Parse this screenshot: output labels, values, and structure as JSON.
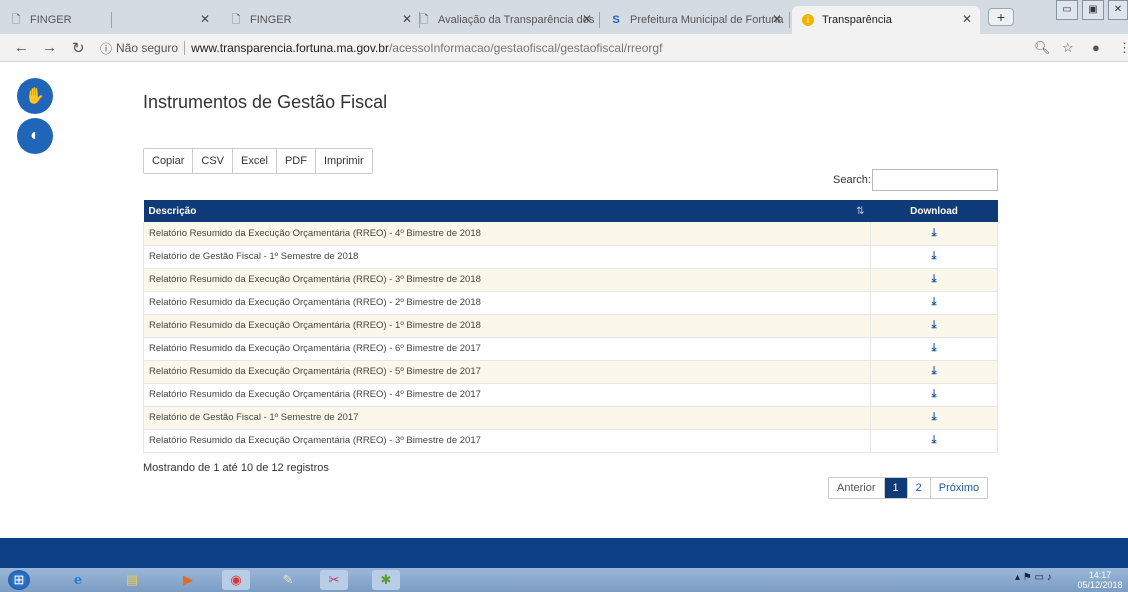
{
  "browser": {
    "tabs": [
      {
        "title": "FINGER",
        "left": 0
      },
      {
        "title": "FINGER",
        "left": 0
      },
      {
        "title": "Avaliação da Transparência dos",
        "left": 0
      },
      {
        "title": "Prefeitura Municipal de Fortuna",
        "left": 0
      },
      {
        "title": "Transparência",
        "left": 0
      }
    ],
    "new_tab": "+",
    "url_info": "ⓘ",
    "url_insecure": "Não seguro",
    "url_host": "www.transparencia.fortuna.ma.gov.br",
    "url_path": "/acessoInformacao/gestaofiscal/gestaofiscal/rreorgf"
  },
  "page": {
    "title": "Instrumentos de Gestão Fiscal",
    "export_buttons": [
      "Copiar",
      "CSV",
      "Excel",
      "PDF",
      "Imprimir"
    ],
    "search_label": "Search:",
    "table": {
      "columns": [
        "Descrição",
        "Download"
      ],
      "rows": [
        "Relatório Resumido da Execução Orçamentária (RREO) - 4º Bimestre de 2018",
        "Relatório de Gestão Fiscal - 1º Semestre de 2018",
        "Relatório Resumido da Execução Orçamentária (RREO) - 3º Bimestre de 2018",
        "Relatório Resumido da Execução Orçamentária (RREO) - 2º Bimestre de 2018",
        "Relatório Resumido da Execução Orçamentária (RREO) - 1º Bimestre de 2018",
        "Relatório Resumido da Execução Orçamentária (RREO) - 6º Bimestre de 2017",
        "Relatório Resumido da Execução Orçamentária (RREO) - 5º Bimestre de 2017",
        "Relatório Resumido da Execução Orçamentária (RREO) - 4º Bimestre de 2017",
        "Relatório de Gestão Fiscal - 1º Semestre de 2017",
        "Relatório Resumido da Execução Orçamentária (RREO) - 3º Bimestre de 2017"
      ]
    },
    "showing": "Mostrando de 1 até 10 de 12 registros",
    "pagination": {
      "prev": "Anterior",
      "pages": [
        "1",
        "2"
      ],
      "next": "Próximo"
    }
  },
  "taskbar": {
    "time": "14:17",
    "date": "05/12/2018"
  },
  "colors": {
    "header_blue": "#0e3a78",
    "accent_blue": "#1f66b8",
    "row_tint": "#fbf7ea"
  }
}
